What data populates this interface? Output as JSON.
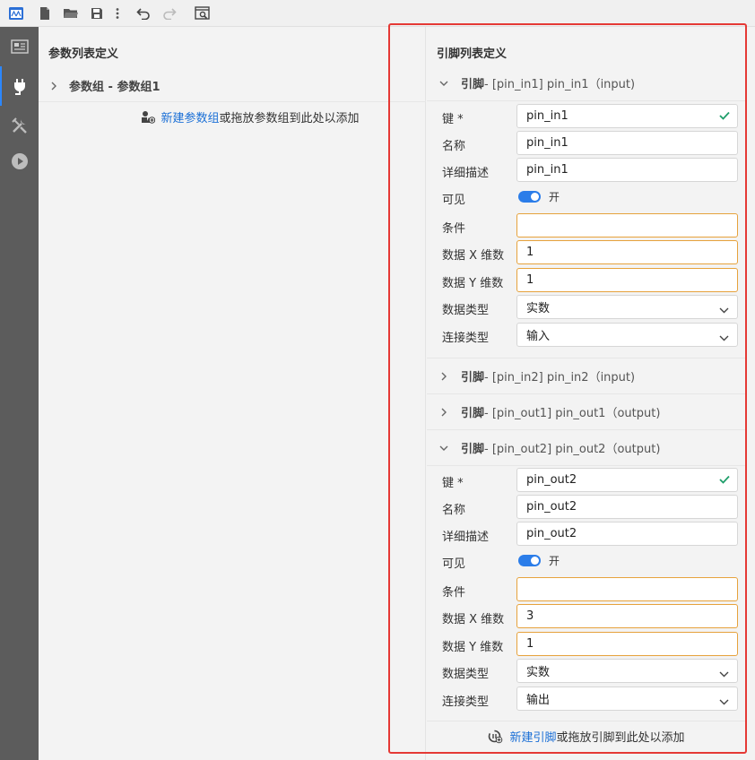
{
  "toolbar": {
    "icons": [
      "app-logo-icon",
      "new-file-icon",
      "open-folder-icon",
      "save-icon",
      "more-icon",
      "undo-icon",
      "redo-icon",
      "preview-icon"
    ]
  },
  "activity_bar": {
    "items": [
      "panel-icon",
      "plugin-icon",
      "tools-icon",
      "play-icon"
    ],
    "active": "plugin-icon"
  },
  "left_panel": {
    "title": "参数列表定义",
    "group_label": "参数组 - 参数组1",
    "add_link": "新建参数组",
    "add_text": "或拖放参数组到此处以添加"
  },
  "right_panel": {
    "title": "引脚列表定义",
    "pins": [
      {
        "name": "引脚",
        "rest": " - [pin_in1] pin_in1（input)",
        "expanded": true
      },
      {
        "name": "引脚",
        "rest": " - [pin_in2] pin_in2（input)",
        "expanded": false
      },
      {
        "name": "引脚",
        "rest": " - [pin_out1] pin_out1（output)",
        "expanded": false
      },
      {
        "name": "引脚",
        "rest": " - [pin_out2] pin_out2（output)",
        "expanded": true
      }
    ],
    "labels": {
      "key": "键 *",
      "name": "名称",
      "desc": "详细描述",
      "visible": "可见",
      "condition": "条件",
      "dim_x": "数据 X 维数",
      "dim_y": "数据 Y 维数",
      "data_type": "数据类型",
      "conn_type": "连接类型",
      "toggle_on": "开"
    },
    "pin_in1": {
      "key": "pin_in1",
      "name": "pin_in1",
      "desc": "pin_in1",
      "condition": "",
      "dim_x": "1",
      "dim_y": "1",
      "data_type": "实数",
      "conn_type": "输入"
    },
    "pin_out2": {
      "key": "pin_out2",
      "name": "pin_out2",
      "desc": "pin_out2",
      "condition": "",
      "dim_x": "3",
      "dim_y": "1",
      "data_type": "实数",
      "conn_type": "输出"
    },
    "add_link": "新建引脚",
    "add_text": "或拖放引脚到此处以添加"
  },
  "colors": {
    "accent": "#1a6fd6",
    "toggle": "#2b7de9",
    "warning_border": "#e6a23c",
    "highlight_box": "#e53935",
    "check": "#1e9e6a",
    "activity_bar": "#5c5c5c"
  }
}
